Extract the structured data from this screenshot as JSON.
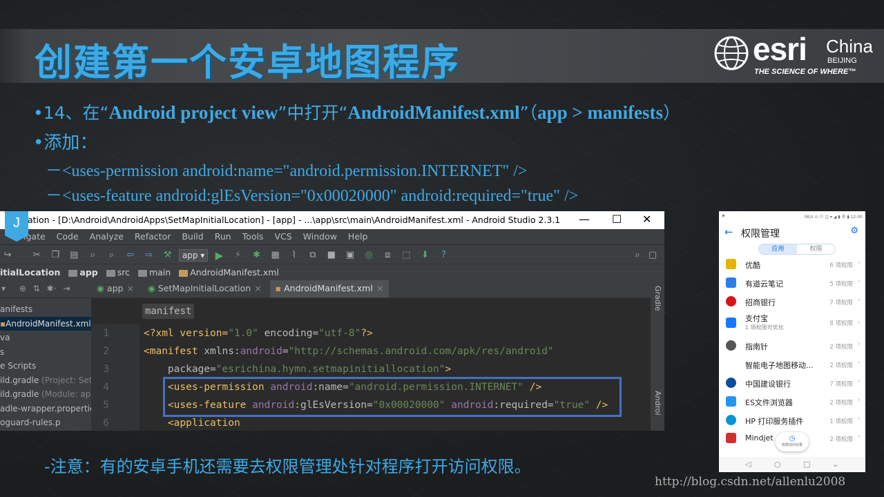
{
  "slide": {
    "title": "创建第一个安卓地图程序",
    "bullet1_prefix": "•14、在“",
    "bullet1_a": "Android project view",
    "bullet1_mid": "”中打开“",
    "bullet1_b": "AndroidManifest.xml",
    "bullet1_mid2": "”（",
    "bullet1_c": "app > manifests",
    "bullet1_end": "）",
    "bullet2": "•添加：",
    "code_line1": "－<uses-permission android:name=\"android.permission.INTERNET\" />",
    "code_line2": "－<uses-feature android:glEsVersion=\"0x00020000\" android:required=\"true\" />",
    "note": "-注意：有的安卓手机还需要去权限管理处针对程序打开访问权限。",
    "watermark": "http://blog.csdn.net/allenlu2008"
  },
  "logo": {
    "word": "esri",
    "china": "China",
    "beijing": "BEIJING",
    "tagline": "THE SCIENCE OF WHERE™"
  },
  "android_studio": {
    "badge": "J",
    "window_title": "ation - [D:\\Android\\AndroidApps\\SetMapInitialLocation] - [app] - ...\\app\\src\\main\\AndroidManifest.xml - Android Studio 2.3.1",
    "menu": [
      "igate",
      "Code",
      "Analyze",
      "Refactor",
      "Build",
      "Run",
      "Tools",
      "VCS",
      "Window",
      "Help"
    ],
    "run_config": "app",
    "breadcrumb": [
      "itialLocation",
      "app",
      "src",
      "main",
      "AndroidManifest.xml"
    ],
    "project_items": [
      {
        "label": "anifests",
        "extra": ""
      },
      {
        "label": "AndroidManifest.xml",
        "extra": ""
      },
      {
        "label": "va",
        "extra": ""
      },
      {
        "label": "s",
        "extra": ""
      },
      {
        "label": "e Scripts",
        "extra": ""
      },
      {
        "label": "ild.gradle",
        "extra": " (Project: SetM"
      },
      {
        "label": "ild.gradle",
        "extra": " (Module: app"
      },
      {
        "label": "adle-wrapper.propertie",
        "extra": ""
      },
      {
        "label": "oguard-rules.p",
        "extra": ""
      }
    ],
    "tabs": [
      "app",
      "SetMapInitialLocation",
      "AndroidManifest.xml"
    ],
    "tag_crumb": "manifest",
    "line_numbers": [
      "1",
      "2",
      "3",
      "4",
      "5",
      "6"
    ],
    "code": {
      "l1_open": "<?xml version=",
      "l1_v": "\"1.0\"",
      "l1_mid": " encoding=",
      "l1_enc": "\"utf-8\"",
      "l1_close": "?>",
      "l2_tag": "<manifest ",
      "l2_attr": "xmlns:",
      "l2_ns": "android",
      "l2_eq": "=",
      "l2_val": "\"http://schemas.android.com/apk/res/android\"",
      "l3_attr": "package=",
      "l3_val": "\"esrichina.hymn.setmapinitiallocation\"",
      "l3_close": ">",
      "l4_tag": "<uses-permission ",
      "l4_ns": "android",
      "l4_attr": ":name=",
      "l4_val": "\"android.permission.INTERNET\"",
      "l4_close": " />",
      "l5_tag": "<uses-feature ",
      "l5_ns": "android",
      "l5_attr": ":glEsVersion=",
      "l5_val": "\"0x00020000\"",
      "l5_ns2": " android",
      "l5_attr2": ":required=",
      "l5_val2": "\"true\"",
      "l5_close": " />",
      "l6_tag": "<application"
    },
    "side_labels": {
      "gradle": "Gradle",
      "android": "Androi"
    }
  },
  "phone": {
    "status_left": "◈",
    "status_right": "0K/s ⊙ ⓝ ◫ ▾ ◢ ▮ 中 ▮ 12:00",
    "title": "权限管理",
    "seg_on": "应用",
    "seg_off": "权限",
    "apps": [
      {
        "name": "优酷",
        "count": "6 项权限",
        "color": "#e6b400"
      },
      {
        "name": "有道云笔记",
        "count": "5 项权限",
        "color": "#2b7de9"
      },
      {
        "name": "招商银行",
        "count": "7 项权限",
        "color": "#d7141a"
      },
      {
        "name": "支付宝",
        "sub": "1 项权限可优化",
        "count": "8 项权限",
        "color": "#1678ff"
      },
      {
        "name": "指南针",
        "count": "2 项权限",
        "color": "#555555"
      },
      {
        "name": "智能电子地图移动...",
        "count": "2 项权限",
        "color": "#ffffff"
      },
      {
        "name": "中国建设银行",
        "count": "7 项权限",
        "color": "#0f4e9c"
      },
      {
        "name": "ES文件浏览器",
        "count": "2 项权限",
        "color": "#2196f3"
      },
      {
        "name": "HP 打印服务插件",
        "count": "1 项权限",
        "color": "#0096d6"
      },
      {
        "name": "Mindjet",
        "count": "2 项权限",
        "color": "#d32f2f"
      }
    ],
    "float_label": "权限访问记录",
    "nav": [
      "◁",
      "○",
      "□",
      "⌄"
    ]
  }
}
